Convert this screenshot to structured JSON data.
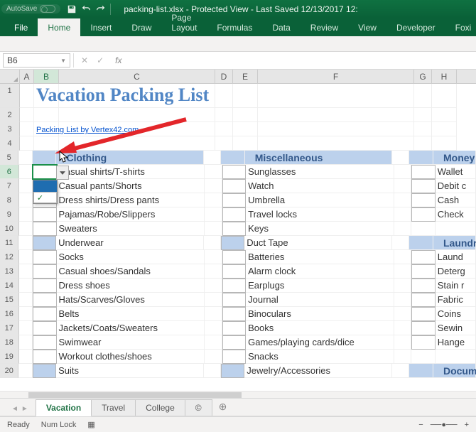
{
  "titlebar": {
    "autosave": "AutoSave",
    "filename": "packing-list.xlsx",
    "state": "Protected View",
    "saved": "Last Saved 12/13/2017 12:"
  },
  "ribbon": {
    "tabs": [
      "File",
      "Home",
      "Insert",
      "Draw",
      "Page Layout",
      "Formulas",
      "Data",
      "Review",
      "View",
      "Developer",
      "Foxi"
    ]
  },
  "namebox": "B6",
  "sheet": {
    "cols": [
      "A",
      "B",
      "C",
      "D",
      "E",
      "F",
      "G",
      "H"
    ],
    "title": "Vacation Packing List",
    "link": "Packing List by Vertex42.com",
    "sections": [
      {
        "head": "Clothing",
        "items": [
          "Casual shirts/T-shirts",
          "Casual pants/Shorts",
          "Dress shirts/Dress pants",
          "Pajamas/Robe/Slippers",
          "Sweaters",
          "Underwear",
          "Socks",
          "Casual shoes/Sandals",
          "Dress shoes",
          "Hats/Scarves/Gloves",
          "Belts",
          "Jackets/Coats/Sweaters",
          "Swimwear",
          "Workout clothes/shoes",
          "Suits"
        ]
      },
      {
        "head": "Miscellaneous",
        "items": [
          "Sunglasses",
          "Watch",
          "Umbrella",
          "Travel locks",
          "Keys",
          "Duct Tape",
          "Batteries",
          "Alarm clock",
          "Earplugs",
          "Journal",
          "Binoculars",
          "Books",
          "Games/playing cards/dice",
          "Snacks",
          "Jewelry/Accessories"
        ]
      },
      {
        "head": "Money",
        "items": [
          "Wallet",
          "Debit c",
          "Cash",
          "Check"
        ]
      },
      {
        "head": "Laundry",
        "items": [
          "Laund",
          "Deterg",
          "Stain r",
          "Fabric",
          "Coins",
          "Sewin",
          "Hange"
        ]
      },
      {
        "head": "Docume",
        "items": []
      }
    ]
  },
  "sheettabs": [
    "Vacation",
    "Travel",
    "College",
    "©"
  ],
  "status": {
    "ready": "Ready",
    "numlock": "Num Lock"
  }
}
